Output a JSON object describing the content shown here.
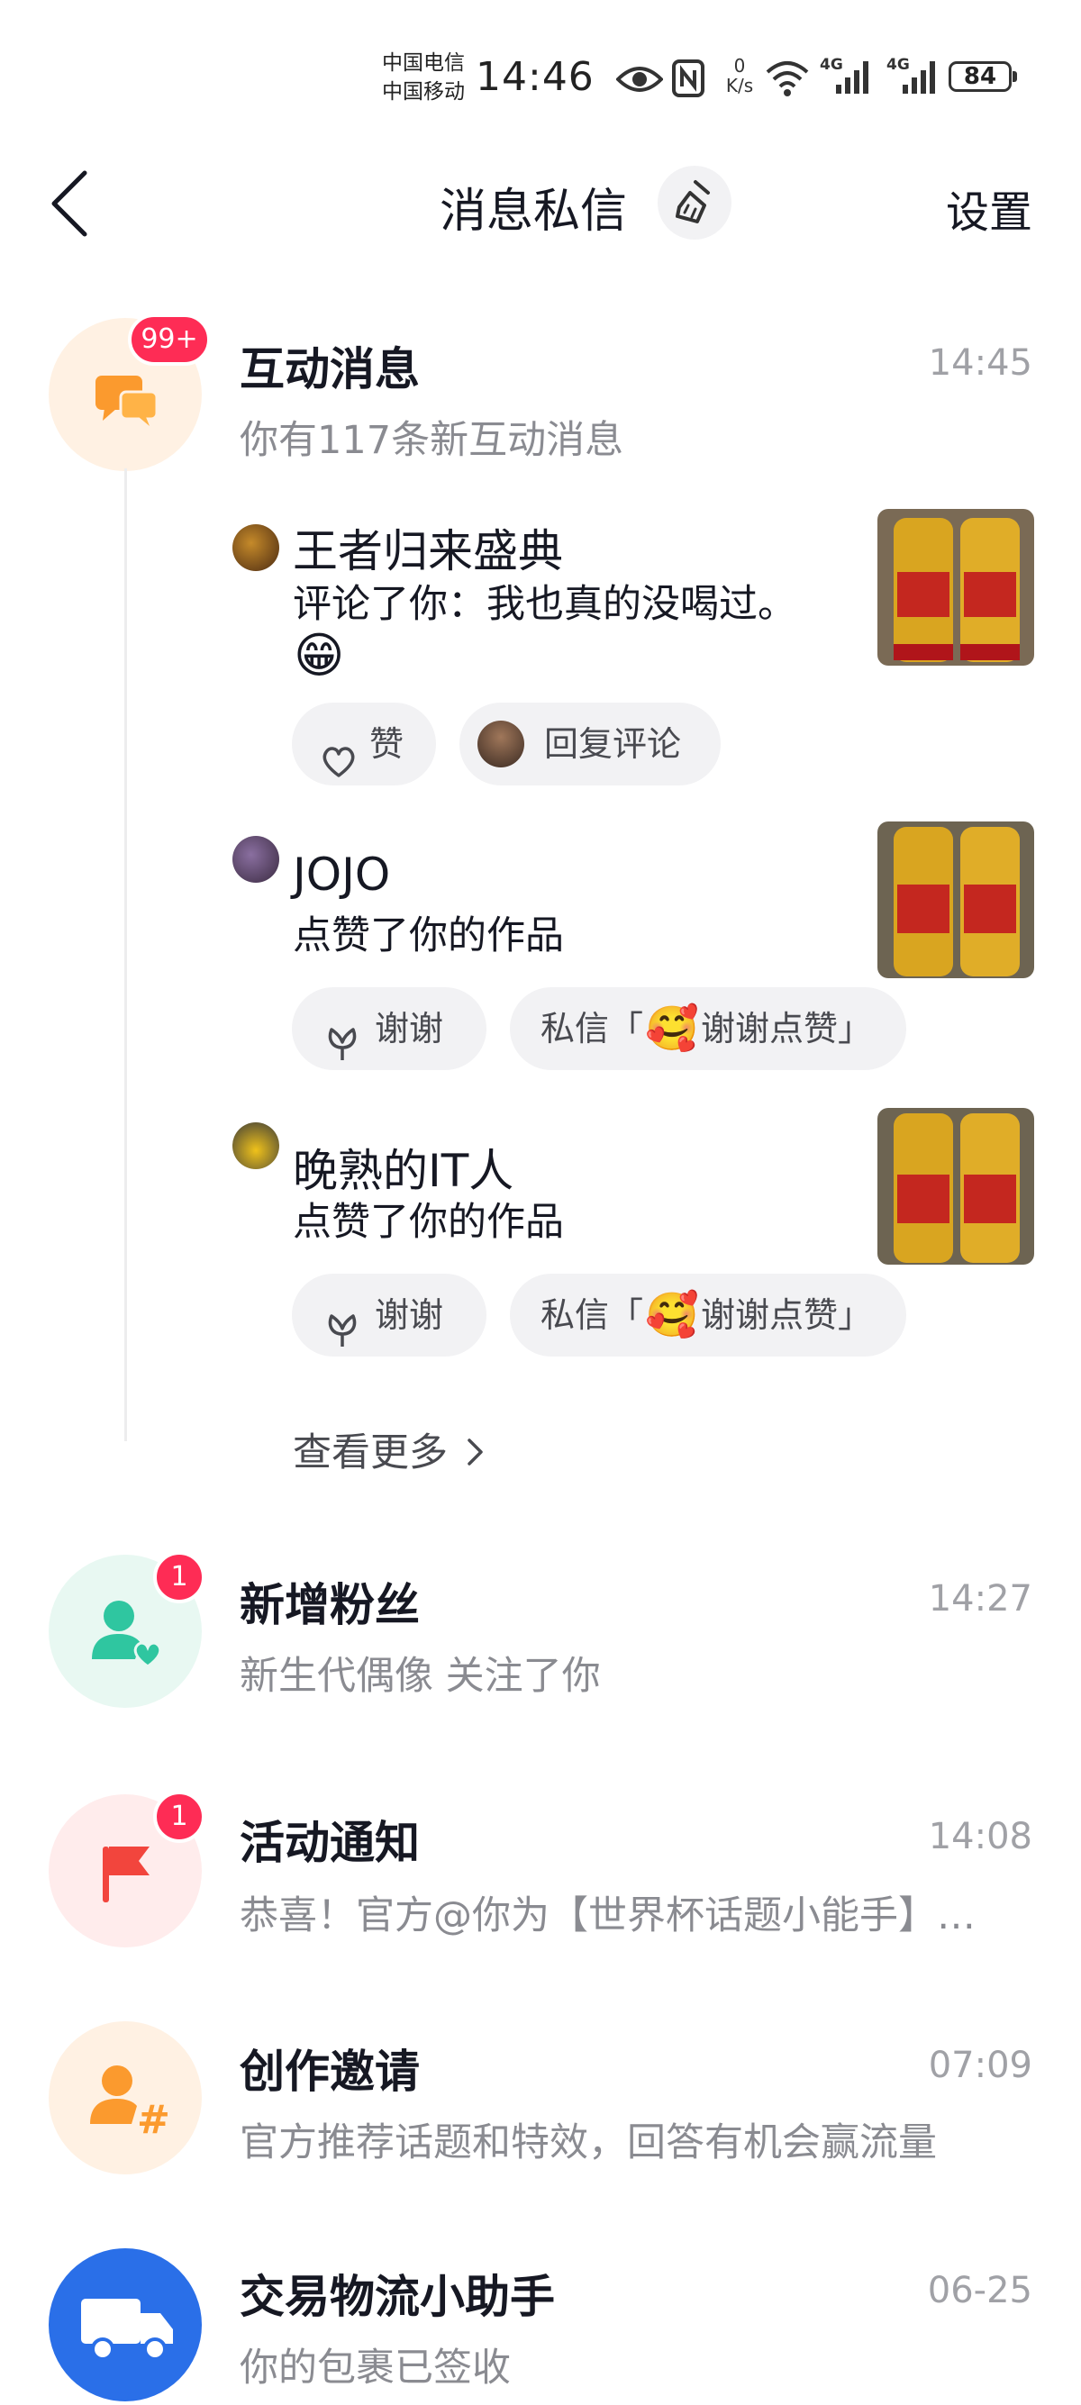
{
  "status_bar": {
    "carrier1": "中国电信",
    "carrier2": "中国移动",
    "time": "14:46",
    "net_speed_value": "0",
    "net_speed_unit": "K/s",
    "signal1": "4G",
    "signal2": "4G",
    "battery": "84"
  },
  "header": {
    "title": "消息私信",
    "settings_label": "设置"
  },
  "interaction": {
    "title": "互动消息",
    "time": "14:45",
    "badge": "99+",
    "subtitle": "你有117条新互动消息",
    "items": [
      {
        "user": "王者归来盛典",
        "text": "评论了你：我也真的没喝过。",
        "emoji": "😁",
        "actions": {
          "like": "赞",
          "reply": "回复评论"
        }
      },
      {
        "user": "JOJO",
        "text": "点赞了你的作品",
        "actions": {
          "thanks": "谢谢",
          "dm_prefix": "私信「",
          "dm_text": "谢谢点赞」"
        }
      },
      {
        "user": "晚熟的IT人",
        "text": "点赞了你的作品",
        "actions": {
          "thanks": "谢谢",
          "dm_prefix": "私信「",
          "dm_text": "谢谢点赞」"
        }
      }
    ],
    "more_label": "查看更多"
  },
  "rows": [
    {
      "title": "新增粉丝",
      "subtitle": "新生代偶像 关注了你",
      "time": "14:27",
      "badge": "1"
    },
    {
      "title": "活动通知",
      "subtitle": "恭喜！官方@你为【世界杯话题小能手】…",
      "time": "14:08",
      "badge": "1"
    },
    {
      "title": "创作邀请",
      "subtitle": "官方推荐话题和特效，回答有机会赢流量",
      "time": "07:09"
    },
    {
      "title": "交易物流小助手",
      "subtitle": "你的包裹已签收",
      "time": "06-25"
    }
  ],
  "colors": {
    "badge": "#fe2c55",
    "orange": "#fb9a2e",
    "green": "#2fc6a0",
    "red": "#f2453d",
    "blue": "#2a6fe8"
  }
}
